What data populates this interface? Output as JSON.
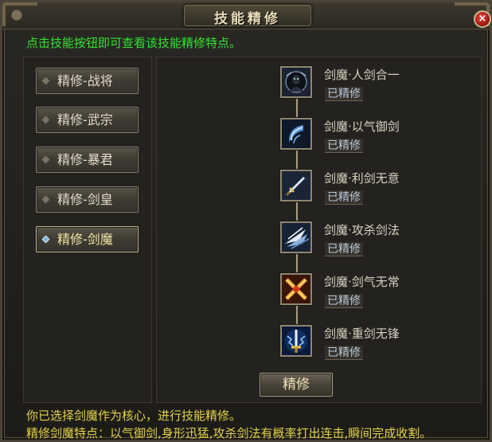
{
  "window": {
    "title": "技能精修",
    "close_label": "×"
  },
  "hint": "点击技能按钮即可查看该技能精修特点。",
  "tabs": [
    {
      "label": "精修-战将",
      "active": false
    },
    {
      "label": "精修-武宗",
      "active": false
    },
    {
      "label": "精修-暴君",
      "active": false
    },
    {
      "label": "精修-剑皇",
      "active": false
    },
    {
      "label": "精修-剑魔",
      "active": true
    }
  ],
  "skills": [
    {
      "name": "剑魔·人剑合一",
      "status": "已精修",
      "icon": "shadow-figure-icon"
    },
    {
      "name": "剑魔·以气御剑",
      "status": "已精修",
      "icon": "blue-crescent-icon"
    },
    {
      "name": "剑魔·利剑无意",
      "status": "已精修",
      "icon": "sword-icon"
    },
    {
      "name": "剑魔·攻杀剑法",
      "status": "已精修",
      "icon": "wind-slash-icon"
    },
    {
      "name": "剑魔·剑气无常",
      "status": "已精修",
      "icon": "crossed-blades-icon"
    },
    {
      "name": "剑魔·重剑无锋",
      "status": "已精修",
      "icon": "lightning-sword-icon"
    }
  ],
  "refine_button": "精修",
  "footer": {
    "line1": "你已选择剑魔作为核心，进行技能精修。",
    "line2": "精修剑魔特点：以气御剑,身形迅猛,攻杀剑法有概率打出连击,瞬间完成收割。"
  }
}
